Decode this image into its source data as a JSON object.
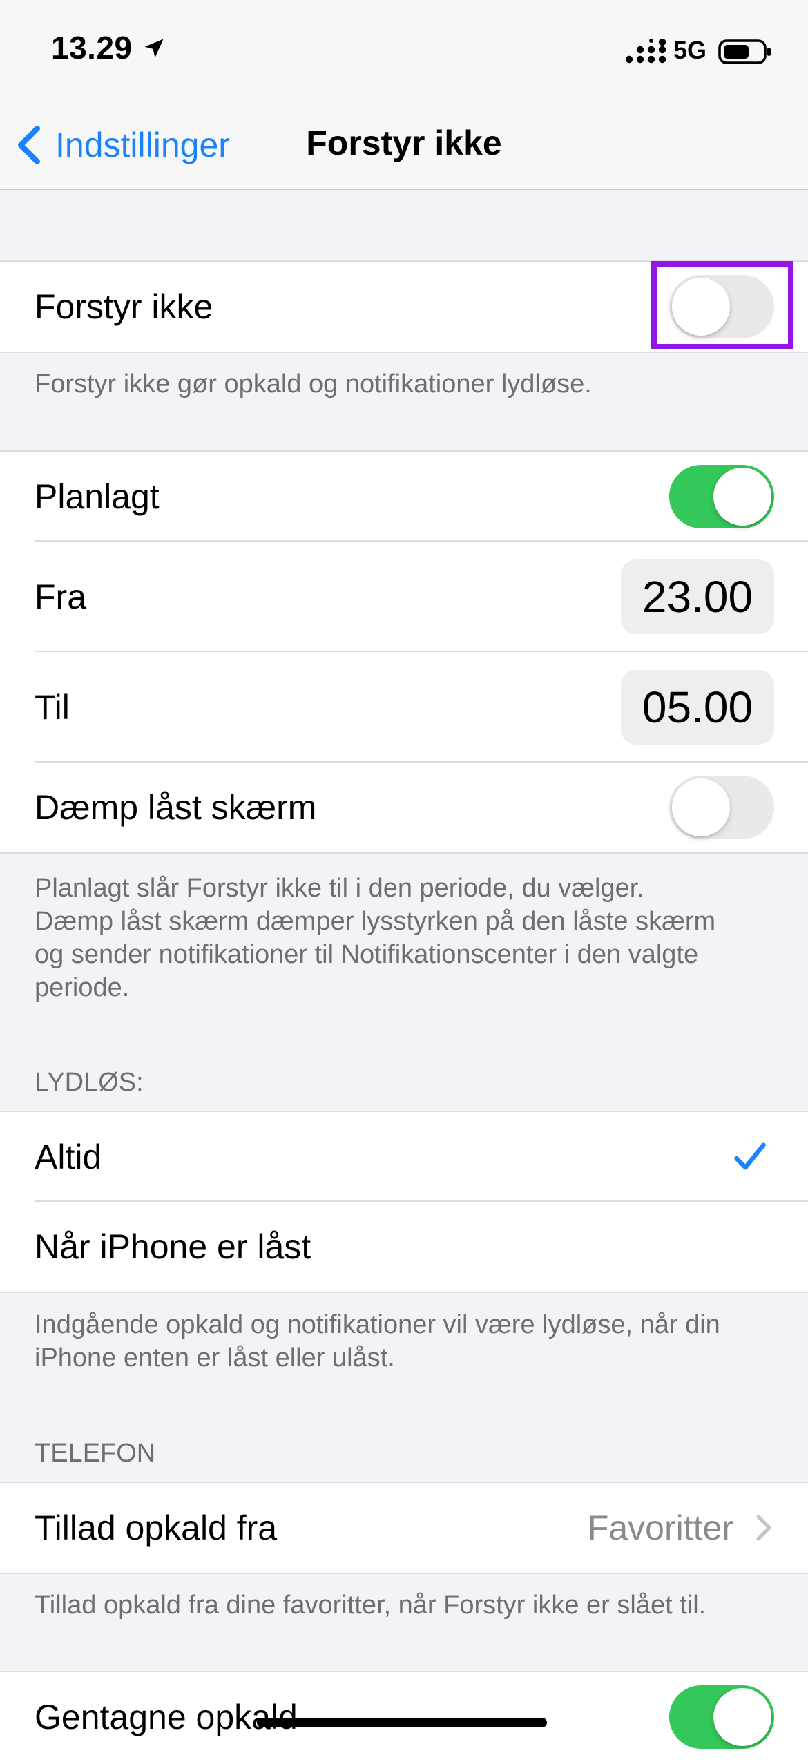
{
  "status_bar": {
    "time": "13.29",
    "network": "5G"
  },
  "nav": {
    "back_label": "Indstillinger",
    "title": "Forstyr ikke"
  },
  "dnd": {
    "label": "Forstyr ikke",
    "enabled": false,
    "footer": "Forstyr ikke gør opkald og notifikationer lydløse."
  },
  "schedule": {
    "scheduled_label": "Planlagt",
    "scheduled_enabled": true,
    "from_label": "Fra",
    "from_value": "23.00",
    "to_label": "Til",
    "to_value": "05.00",
    "dim_label": "Dæmp låst skærm",
    "dim_enabled": false,
    "footer_line1": "Planlagt slår Forstyr ikke til i den periode, du vælger.",
    "footer_line2": "Dæmp låst skærm dæmper lysstyrken på den låste skærm",
    "footer_line3": "og sender notifikationer til Notifikationscenter i den valgte",
    "footer_line4": "periode."
  },
  "silence": {
    "header": "LYDLØS:",
    "options": [
      {
        "label": "Altid",
        "selected": true
      },
      {
        "label": "Når iPhone er låst",
        "selected": false
      }
    ],
    "footer_line1": "Indgående opkald og notifikationer vil være lydløse, når din",
    "footer_line2": "iPhone enten er låst eller ulåst."
  },
  "phone": {
    "header": "TELEFON",
    "allow_calls_label": "Tillad opkald fra",
    "allow_calls_value": "Favoritter",
    "footer": "Tillad opkald fra dine favoritter, når Forstyr ikke er slået til.",
    "repeated_calls_label": "Gentagne opkald",
    "repeated_calls_enabled": true
  },
  "colors": {
    "accent_blue": "#1a82fb",
    "toggle_on_green": "#34c759",
    "highlight_purple": "#9316e6",
    "background": "#f2f2f7"
  }
}
